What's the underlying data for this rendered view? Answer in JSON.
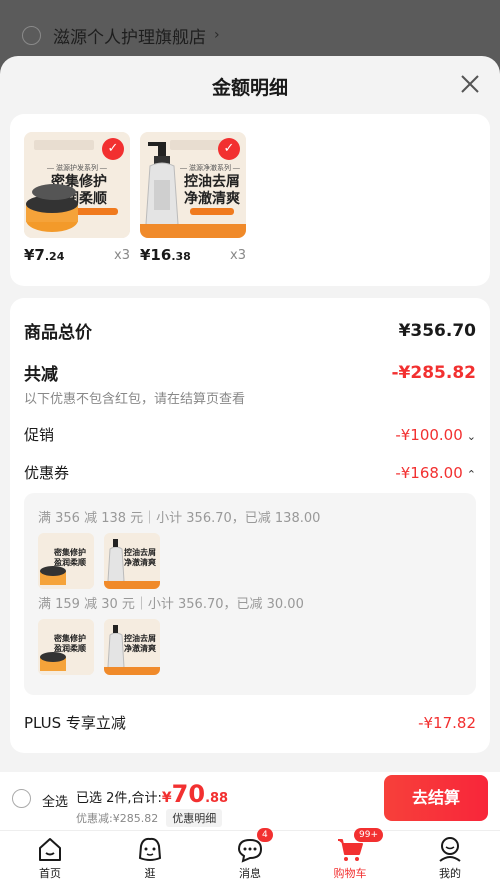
{
  "background": {
    "store_name": "滋源个人护理旗舰店"
  },
  "sheet": {
    "title": "金额明细"
  },
  "products": [
    {
      "banner1": "密集修护",
      "banner2": "盈润柔顺",
      "price_int": "¥7",
      "price_dec": ".24",
      "qty": "x3",
      "kind": "jar"
    },
    {
      "banner1": "控油去屑",
      "banner2": "净澈清爽",
      "price_int": "¥16",
      "price_dec": ".38",
      "qty": "x3",
      "kind": "bottle"
    }
  ],
  "details": {
    "total_label": "商品总价",
    "total_value": "¥356.70",
    "reduce_label": "共减",
    "reduce_value": "-¥285.82",
    "note": "以下优惠不包含红包，请在结算页查看",
    "promo_label": "促销",
    "promo_value": "-¥100.00",
    "coupon_label": "优惠券",
    "coupon_value": "-¥168.00",
    "coupon_lines": [
      "满 356 减 138 元｜小计 356.70，已减 138.00",
      "满 159 减 30 元｜小计 356.70，已减 30.00"
    ],
    "plus_label": "PLUS 专享立减",
    "plus_value": "-¥17.82"
  },
  "checkout": {
    "select_all": "全选",
    "selected_text": "已选 2件,合计:",
    "currency": "¥",
    "total_int": "70",
    "total_dec": ".88",
    "discount_text": "优惠减:¥285.82",
    "detail_tag": "优惠明细",
    "button": "去结算"
  },
  "tabs": [
    {
      "label": "首页"
    },
    {
      "label": "逛"
    },
    {
      "label": "消息",
      "badge": "4"
    },
    {
      "label": "购物车",
      "badge": "99+"
    },
    {
      "label": "我的"
    }
  ],
  "colors": {
    "accent": "#f23030"
  }
}
